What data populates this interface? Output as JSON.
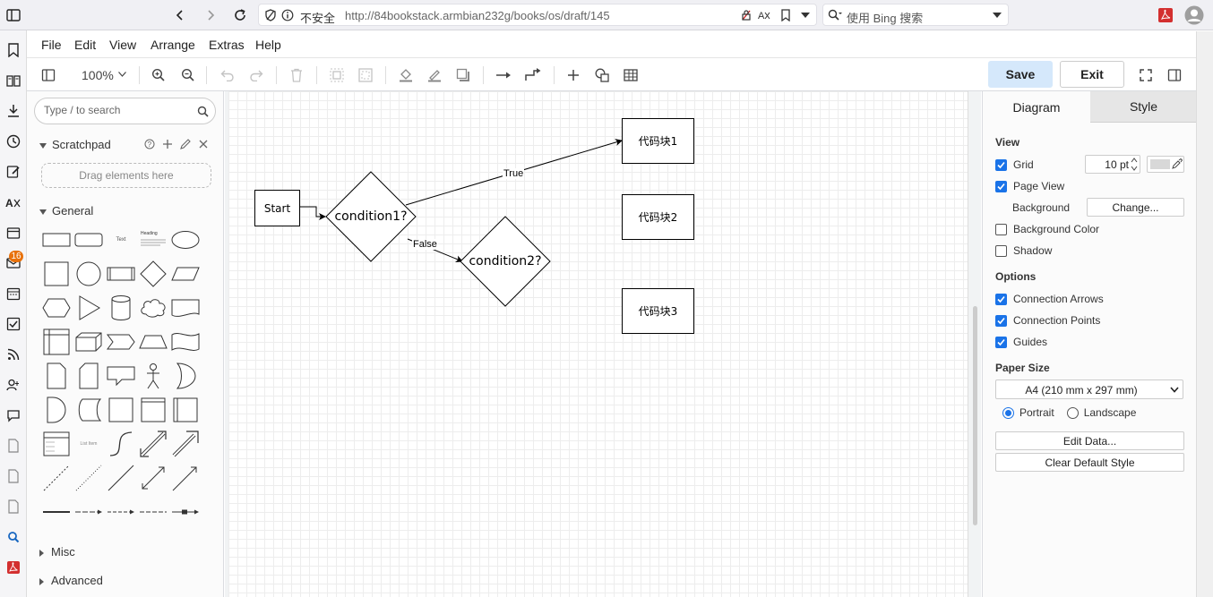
{
  "browser": {
    "security_label": "不安全",
    "url": "http://84bookstack.armbian232g/books/os/draft/145",
    "search_placeholder": "使用 Bing 搜索",
    "mail_badge": "16"
  },
  "menu": {
    "items": [
      "File",
      "Edit",
      "View",
      "Arrange",
      "Extras",
      "Help"
    ]
  },
  "toolbar": {
    "zoom": "100%",
    "save_label": "Save",
    "exit_label": "Exit"
  },
  "shapes_panel": {
    "search_placeholder": "Type / to search",
    "scratchpad_label": "Scratchpad",
    "drag_hint": "Drag elements here",
    "general_label": "General",
    "misc_label": "Misc",
    "advanced_label": "Advanced",
    "text_shape_label": "Text",
    "heading_shape_label": "Heading",
    "list_item_label": "List Item"
  },
  "diagram": {
    "nodes": {
      "start": "Start",
      "condition1": "condition1?",
      "condition2": "condition2?",
      "block1": "代码块1",
      "block2": "代码块2",
      "block3": "代码块3"
    },
    "edges": {
      "true_label": "True",
      "false_label": "False"
    }
  },
  "format_panel": {
    "tab_diagram": "Diagram",
    "tab_style": "Style",
    "view_header": "View",
    "grid_label": "Grid",
    "grid_checked": true,
    "grid_size": "10 pt",
    "page_view_label": "Page View",
    "page_view_checked": true,
    "background_label": "Background",
    "change_button": "Change...",
    "background_color_label": "Background Color",
    "background_color_checked": false,
    "shadow_label": "Shadow",
    "shadow_checked": false,
    "options_header": "Options",
    "connection_arrows_label": "Connection Arrows",
    "connection_arrows_checked": true,
    "connection_points_label": "Connection Points",
    "connection_points_checked": true,
    "guides_label": "Guides",
    "guides_checked": true,
    "paper_size_header": "Paper Size",
    "paper_size_value": "A4 (210 mm x 297 mm)",
    "portrait_label": "Portrait",
    "landscape_label": "Landscape",
    "orientation_selected": "Portrait",
    "edit_data_button": "Edit Data...",
    "clear_default_style_button": "Clear Default Style"
  },
  "colors": {
    "accent": "#1a73e8",
    "save_bg": "#d5e8fb",
    "badge": "#e8710a",
    "pdf_red": "#d32f2f"
  }
}
